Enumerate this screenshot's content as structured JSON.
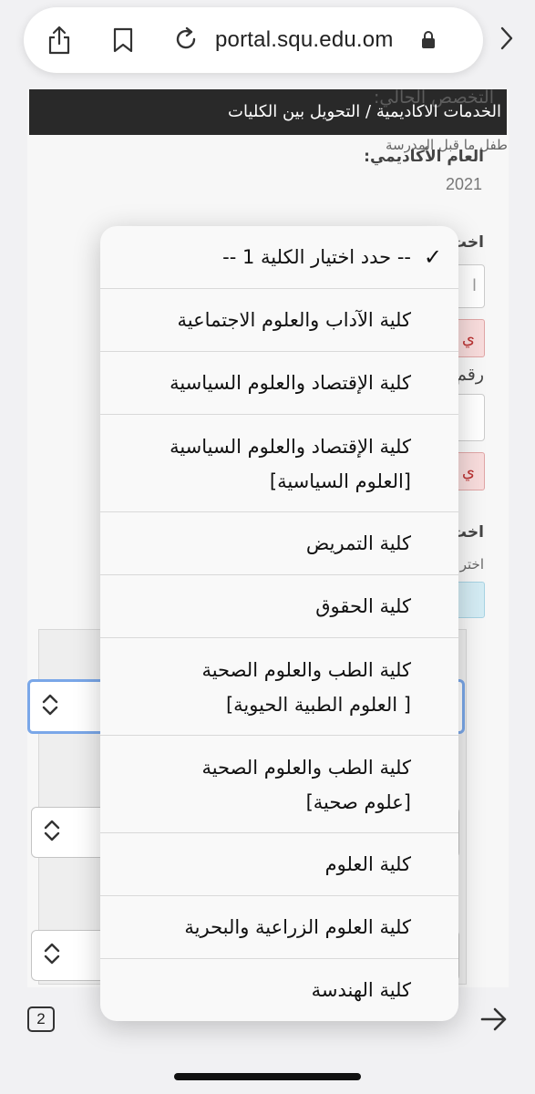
{
  "browser": {
    "url": "portal.squ.edu.om",
    "tab_count": "2",
    "icons": [
      "share-icon",
      "bookmark-icon",
      "reload-icon",
      "lock-icon",
      "chevron-right-icon",
      "arrow-right-icon"
    ]
  },
  "page": {
    "breadcrumb": "الخدمات الاكاديمية / التحويل بين الكليات",
    "current_major_label": "التخصص الحالي:",
    "current_major_value": "طفل ما قبل المدرسة",
    "academic_year_label": "العام الأكاديمي:",
    "academic_year_value": "2021",
    "choose_partial": "اخت",
    "number_partial": "رقم",
    "error_partial": "ي",
    "choose_partial_2": "اخت",
    "choose_small_partial": "اختر",
    "input_partial": "ا"
  },
  "dropdown": {
    "selected_index": 0,
    "options": [
      {
        "lines": [
          "-- حدد اختيار الكلية 1 --"
        ]
      },
      {
        "lines": [
          "كلية الآداب والعلوم الاجتماعية"
        ]
      },
      {
        "lines": [
          "كلية الإقتصاد والعلوم السياسية"
        ]
      },
      {
        "lines": [
          "كلية الإقتصاد والعلوم السياسية",
          "[العلوم السياسية]"
        ]
      },
      {
        "lines": [
          "كلية التمريض"
        ]
      },
      {
        "lines": [
          "كلية الحقوق"
        ]
      },
      {
        "lines": [
          "كلية الطب والعلوم الصحية",
          "[ العلوم الطبية الحيوية]"
        ]
      },
      {
        "lines": [
          "كلية الطب والعلوم الصحية",
          "[علوم صحية]"
        ]
      },
      {
        "lines": [
          "كلية العلوم"
        ]
      },
      {
        "lines": [
          "كلية العلوم الزراعية والبحرية"
        ]
      },
      {
        "lines": [
          "كلية الهندسة"
        ]
      }
    ]
  }
}
